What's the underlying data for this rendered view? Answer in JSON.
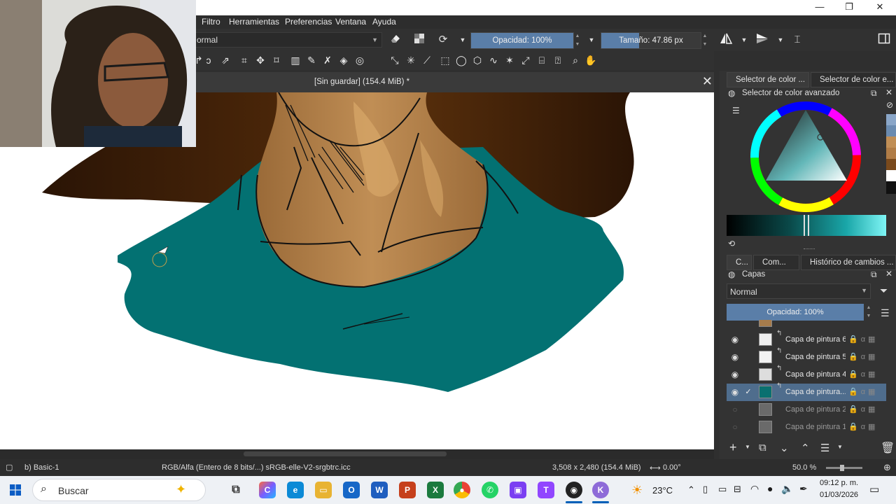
{
  "window": {
    "minimize": "—",
    "restore": "❐",
    "close": "✕"
  },
  "menu": [
    "Filtro",
    "Herramientas",
    "Preferencias",
    "Ventana",
    "Ayuda"
  ],
  "toolbar": {
    "blend_mode": "ormal",
    "opacity_label": "Opacidad: 100%",
    "opacity_fraction": 1.0,
    "size_label": "Tamaño: 47.86 px",
    "size_fraction": 0.38
  },
  "document": {
    "title": "[Sin guardar]  (154.4 MiB) *",
    "close": "✕"
  },
  "docker": {
    "tab_color_1": "Selector de color ...",
    "tab_color_2": "Selector de color e...",
    "color_panel_title": "Selector de color avanzado",
    "tab_c": "C...",
    "tab_com": "Com...",
    "tab_history": "Histórico de cambios ...",
    "layers_title": "Capas",
    "layers_blend": "Normal",
    "layers_opacity": "Opacidad:  100%",
    "layers": [
      {
        "name": "Capa de pintura 6",
        "visible": true,
        "selected": false,
        "checked": false
      },
      {
        "name": "Capa de pintura 5",
        "visible": true,
        "selected": false,
        "checked": false
      },
      {
        "name": "Capa de pintura 4",
        "visible": true,
        "selected": false,
        "checked": false
      },
      {
        "name": "Capa de pintura...",
        "visible": true,
        "selected": true,
        "checked": true
      },
      {
        "name": "Capa de pintura 2",
        "visible": false,
        "selected": false,
        "checked": false
      },
      {
        "name": "Capa de pintura 1",
        "visible": false,
        "selected": false,
        "checked": false
      }
    ]
  },
  "statusbar": {
    "brush": "b) Basic-1",
    "color_model": "RGB/Alfa (Entero de 8 bits/...)  sRGB-elle-V2-srgbtrc.icc",
    "dimensions": "3,508 x 2,480 (154.4 MiB)",
    "rotation": "0.00°",
    "zoom": "50.0 %"
  },
  "taskbar": {
    "search_placeholder": "Buscar",
    "weather": "23°C",
    "time": "09:12 p. m.",
    "date": "01/03/2026"
  },
  "colors": {
    "shirt": "#037172",
    "skin": "#b07c46",
    "hair": "#2e1706",
    "accent": "#5a7ea8"
  }
}
